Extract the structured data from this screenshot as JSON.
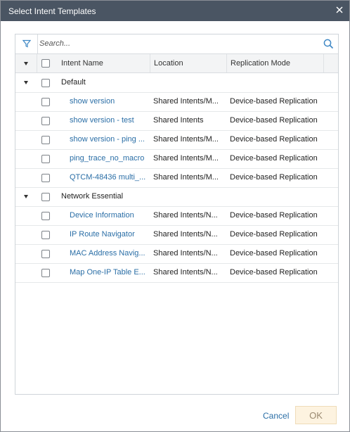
{
  "dialog": {
    "title": "Select Intent Templates"
  },
  "search": {
    "placeholder": "Search..."
  },
  "columns": {
    "name": "Intent Name",
    "location": "Location",
    "mode": "Replication Mode"
  },
  "groups": [
    {
      "label": "Default",
      "rows": [
        {
          "name": "show version",
          "location": "Shared Intents/M...",
          "mode": "Device-based Replication"
        },
        {
          "name": "show version - test",
          "location": "Shared Intents",
          "mode": "Device-based Replication"
        },
        {
          "name": "show version - ping ...",
          "location": "Shared Intents/M...",
          "mode": "Device-based Replication"
        },
        {
          "name": "ping_trace_no_macro",
          "location": "Shared Intents/M...",
          "mode": "Device-based Replication"
        },
        {
          "name": "QTCM-48436 multi_...",
          "location": "Shared Intents/M...",
          "mode": "Device-based Replication"
        }
      ]
    },
    {
      "label": "Network Essential",
      "rows": [
        {
          "name": "Device Information",
          "location": "Shared Intents/N...",
          "mode": "Device-based Replication"
        },
        {
          "name": "IP Route Navigator",
          "location": "Shared Intents/N...",
          "mode": "Device-based Replication"
        },
        {
          "name": "MAC Address Navig...",
          "location": "Shared Intents/N...",
          "mode": "Device-based Replication"
        },
        {
          "name": "Map One-IP Table E...",
          "location": "Shared Intents/N...",
          "mode": "Device-based Replication"
        }
      ]
    }
  ],
  "footer": {
    "cancel": "Cancel",
    "ok": "OK"
  },
  "colors": {
    "titlebar": "#4a5563",
    "link": "#2a6ea6",
    "ok_bg": "#fdf3e0"
  }
}
